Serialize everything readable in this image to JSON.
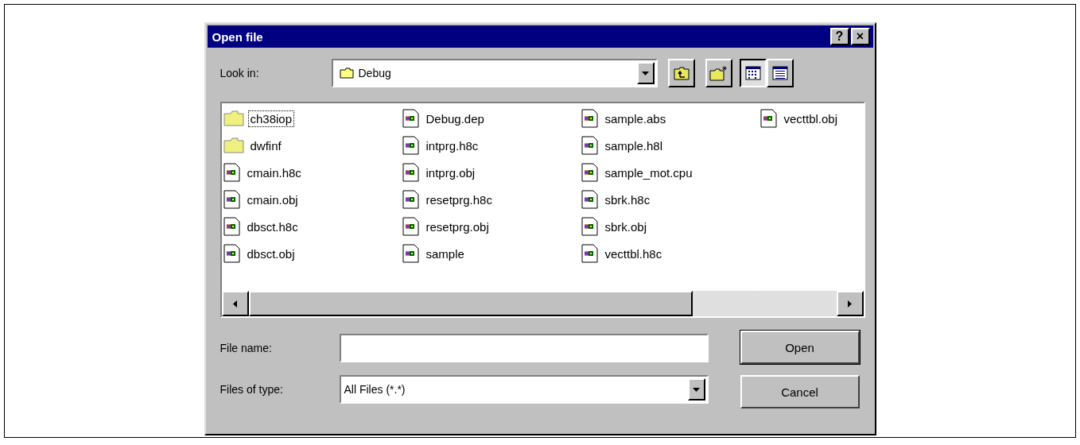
{
  "window": {
    "title": "Open file",
    "title_buttons": [
      "?",
      "×"
    ]
  },
  "look_in": {
    "label": "Look in:",
    "value": "Debug"
  },
  "view_buttons": [
    {
      "kind": "list",
      "selected": true
    },
    {
      "kind": "details",
      "selected": false
    }
  ],
  "files": [
    {
      "name": "ch38iop",
      "kind": "folder",
      "selected": true
    },
    {
      "name": "dwfinf",
      "kind": "folder",
      "selected": false
    },
    {
      "name": "cmain.h8c",
      "kind": "file",
      "selected": false
    },
    {
      "name": "cmain.obj",
      "kind": "file",
      "selected": false
    },
    {
      "name": "dbsct.h8c",
      "kind": "file",
      "selected": false
    },
    {
      "name": "dbsct.obj",
      "kind": "file",
      "selected": false
    },
    {
      "name": "Debug.dep",
      "kind": "file",
      "selected": false
    },
    {
      "name": "intprg.h8c",
      "kind": "file",
      "selected": false
    },
    {
      "name": "intprg.obj",
      "kind": "file",
      "selected": false
    },
    {
      "name": "resetprg.h8c",
      "kind": "file",
      "selected": false
    },
    {
      "name": "resetprg.obj",
      "kind": "file",
      "selected": false
    },
    {
      "name": "sample",
      "kind": "file",
      "selected": false
    },
    {
      "name": "sample.abs",
      "kind": "file",
      "selected": false
    },
    {
      "name": "sample.h8l",
      "kind": "file",
      "selected": false
    },
    {
      "name": "sample_mot.cpu",
      "kind": "file",
      "selected": false
    },
    {
      "name": "sbrk.h8c",
      "kind": "file",
      "selected": false
    },
    {
      "name": "sbrk.obj",
      "kind": "file",
      "selected": false
    },
    {
      "name": "vecttbl.h8c",
      "kind": "file",
      "selected": false
    },
    {
      "name": "vecttbl.obj",
      "kind": "file",
      "selected": false
    }
  ],
  "file_name": {
    "label": "File name:"
  },
  "file_type": {
    "label": "Files of type:",
    "value": "All Files (*.*)"
  },
  "buttons": [
    "Open",
    "Cancel"
  ]
}
